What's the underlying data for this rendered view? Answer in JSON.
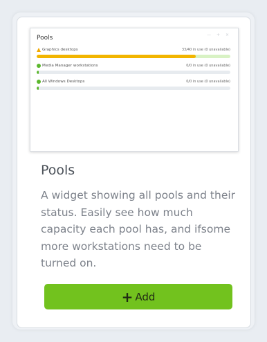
{
  "card": {
    "title": "Pools",
    "description": "A widget showing all pools and their status. Easily see how much capacity each pool has, and ifsome more workstations need to be turned on.",
    "add_label": "Add",
    "add_icon": "+"
  },
  "preview": {
    "title": "Pools",
    "window_controls": "— + ×",
    "pools": [
      {
        "name": "Graphics desktops",
        "status": "33/40 in use (0 unavailable)",
        "icon": "warning-icon",
        "fill_fraction": 0.82,
        "fill_color": "#f2b500",
        "track_color": "#d8f2c4"
      },
      {
        "name": "Media Manager workstations",
        "status": "0/0 in use (0 unavailable)",
        "icon": "check-icon",
        "fill_fraction": 0.0,
        "fill_color": "#5cb82e",
        "track_color": "#e7ebef"
      },
      {
        "name": "All Windows Desktops",
        "status": "0/0 in use (0 unavailable)",
        "icon": "check-icon",
        "fill_fraction": 0.0,
        "fill_color": "#5cb82e",
        "track_color": "#e7ebef"
      }
    ]
  },
  "colors": {
    "accent": "#72c21e",
    "warning": "#f2a900",
    "ok": "#5cb82e"
  }
}
